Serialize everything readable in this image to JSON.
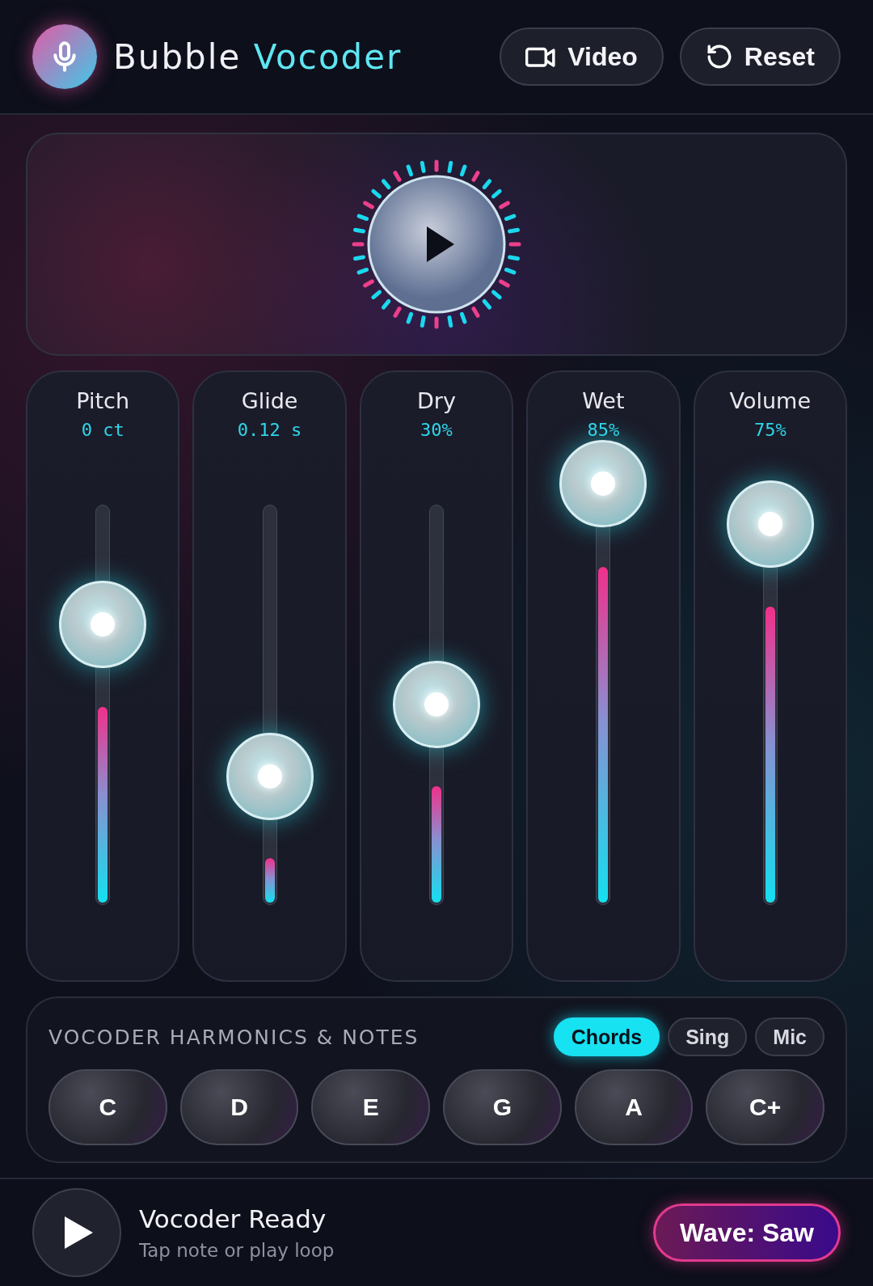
{
  "app": {
    "title_first": "Bubble",
    "title_second": "Vocoder"
  },
  "header_buttons": [
    {
      "kind": "video",
      "label": "Video"
    },
    {
      "kind": "reset",
      "label": "Reset"
    }
  ],
  "sliders": [
    {
      "name": "Pitch",
      "reading": "0 ct",
      "level": 0.5
    },
    {
      "name": "Glide",
      "reading": "0.12 s",
      "level": 0.12
    },
    {
      "name": "Dry",
      "reading": "30%",
      "level": 0.3
    },
    {
      "name": "Wet",
      "reading": "85%",
      "level": 0.85
    },
    {
      "name": "Volume",
      "reading": "75%",
      "level": 0.75
    }
  ],
  "harmonics": {
    "title": "VOCODER HARMONICS & NOTES",
    "modes": [
      {
        "label": "Chords",
        "selected": true
      },
      {
        "label": "Sing",
        "selected": false
      },
      {
        "label": "Mic",
        "selected": false
      }
    ],
    "notes": [
      "C",
      "D",
      "E",
      "G",
      "A",
      "C+"
    ]
  },
  "footer": {
    "status": "Vocoder Ready",
    "hint": "Tap note or play loop",
    "wave": "Wave: Saw"
  }
}
